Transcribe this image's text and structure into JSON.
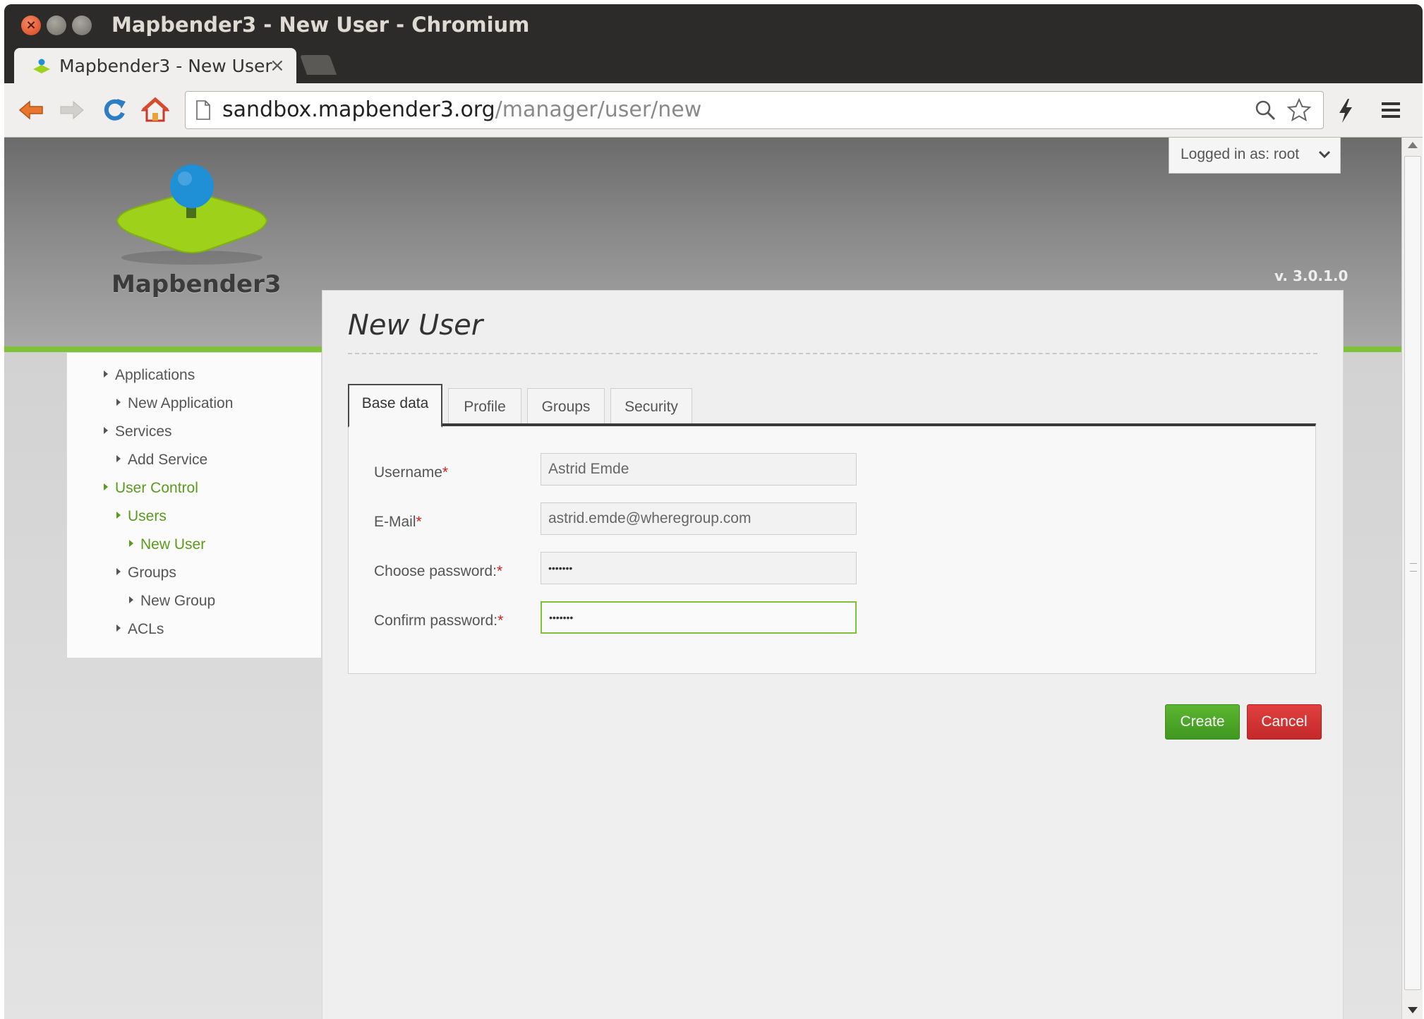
{
  "window": {
    "title": "Mapbender3 - New User - Chromium"
  },
  "browser": {
    "tab_title": "Mapbender3 - New User",
    "tab_close": "×",
    "url_host": "sandbox.mapbender3.org",
    "url_path": "/manager/user/new"
  },
  "header": {
    "logo_text": "Mapbender3",
    "user_menu_label": "Logged in as: root",
    "version": "v. 3.0.1.0"
  },
  "sidebar": {
    "items": [
      {
        "label": "Applications"
      },
      {
        "label": "New Application"
      },
      {
        "label": "Services"
      },
      {
        "label": "Add Service"
      },
      {
        "label": "User Control"
      },
      {
        "label": "Users"
      },
      {
        "label": "New User"
      },
      {
        "label": "Groups"
      },
      {
        "label": "New Group"
      },
      {
        "label": "ACLs"
      }
    ]
  },
  "main": {
    "title": "New User",
    "tabs": [
      {
        "label": "Base data"
      },
      {
        "label": "Profile"
      },
      {
        "label": "Groups"
      },
      {
        "label": "Security"
      }
    ],
    "form": {
      "username_label": "Username",
      "username_value": "Astrid Emde",
      "email_label": "E-Mail",
      "email_value": "astrid.emde@wheregroup.com",
      "password_label": "Choose password:",
      "password_value": "•••••••",
      "confirm_label": "Confirm password:",
      "confirm_value": "•••••••",
      "required_marker": "*"
    },
    "create_label": "Create",
    "cancel_label": "Cancel"
  },
  "colors": {
    "accent_green": "#7ec235",
    "create_green": "#4caa28",
    "cancel_red": "#d33434",
    "logo_blue": "#1f8fd6",
    "logo_lime": "#9dd11a"
  }
}
